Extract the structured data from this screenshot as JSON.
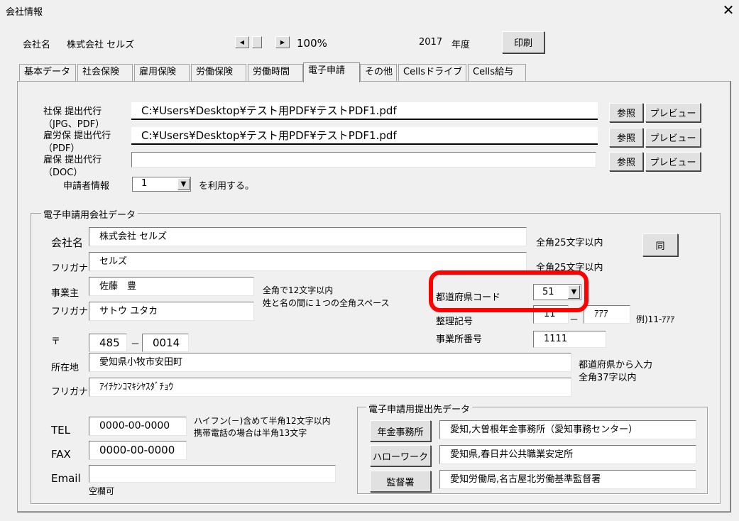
{
  "window": {
    "title": "会社情報",
    "close": "✕"
  },
  "header": {
    "company_label": "会社名",
    "company_name": "株式会社 セルズ",
    "zoom": "100%",
    "year": "2017",
    "year_suffix": "年度",
    "print_button": "印刷"
  },
  "tabs": [
    {
      "label": "基本データ"
    },
    {
      "label": "社会保険"
    },
    {
      "label": "雇用保険"
    },
    {
      "label": "労働保険"
    },
    {
      "label": "労働時間"
    },
    {
      "label": "電子申請"
    },
    {
      "label": "その他"
    },
    {
      "label": "Cellsドライブ"
    },
    {
      "label": "Cells給与"
    }
  ],
  "proxy": {
    "rows": [
      {
        "label1": "社保 提出代行",
        "label2": "（JPG、PDF）",
        "value": "C:¥Users¥Desktop¥テスト用PDF¥テストPDF1.pdf",
        "browse": "参照",
        "preview": "プレビュー"
      },
      {
        "label1": "雇労保 提出代行",
        "label2": "（PDF）",
        "value": "C:¥Users¥Desktop¥テスト用PDF¥テストPDF1.pdf",
        "browse": "参照",
        "preview": "プレビュー"
      },
      {
        "label1": "雇保 提出代行",
        "label2": "（DOC）",
        "value": "",
        "browse": "参照",
        "preview": "プレビュー"
      }
    ],
    "applicant_label": "申請者情報",
    "applicant_value": "1",
    "applicant_suffix": "を利用する。"
  },
  "company_data": {
    "group_title": "電子申請用会社データ",
    "name_label": "会社名",
    "name_value": "株式会社 セルズ",
    "name_note": "全角25文字以内",
    "same_button": "同",
    "furigana_label": "フリガナ",
    "furigana_value": "セルズ",
    "furigana_note": "全角25文字以内",
    "owner_label": "事業主",
    "owner_value": "佐藤　豊",
    "owner_furigana_label": "フリガナ",
    "owner_furigana_value": "サトウ ユタカ",
    "owner_note1": "全角で12文字以内",
    "owner_note2": "姓と名の間に１つの全角スペース",
    "pref_code_label": "都道府県コード",
    "pref_code_value": "51",
    "seiri_label": "整理記号",
    "seiri_value1": "11",
    "seiri_dash": "－",
    "seiri_value2": "ｱｱｱ",
    "seiri_example": "例)11-ｱｱｱ",
    "office_no_label": "事業所番号",
    "office_no_value": "1111",
    "postal_mark": "〒",
    "postal1": "485",
    "postal_dash": "－",
    "postal2": "0014",
    "address_label": "所在地",
    "address_value": "愛知県小牧市安田町",
    "address_note1": "都道府県から入力",
    "address_note2": "全角37字以内",
    "address_furigana_label": "フリガナ",
    "address_furigana_value": "ｱｲﾁｹﾝｺﾏｷｼﾔｽﾀﾞﾁｮｳ",
    "tel_label": "TEL",
    "tel_value": "0000-00-0000",
    "tel_note1": "ハイフン(－)含めて半角12文字以内",
    "tel_note2": "携帯電話の場合は半角13文字",
    "fax_label": "FAX",
    "fax_value": "0000-00-0000",
    "email_label": "Email",
    "email_value": "",
    "email_note": "空欄可"
  },
  "submit_to": {
    "group_title": "電子申請用提出先データ",
    "rows": [
      {
        "button": "年金事務所",
        "value": "愛知,大曽根年金事務所（愛知事務センター）"
      },
      {
        "button": "ハローワーク",
        "value": "愛知県,春日井公共職業安定所"
      },
      {
        "button": "監督署",
        "value": "愛知労働局,名古屋北労働基準監督署"
      }
    ]
  },
  "colors": {
    "highlight": "#ff0000",
    "background": "#f0f0f0"
  }
}
